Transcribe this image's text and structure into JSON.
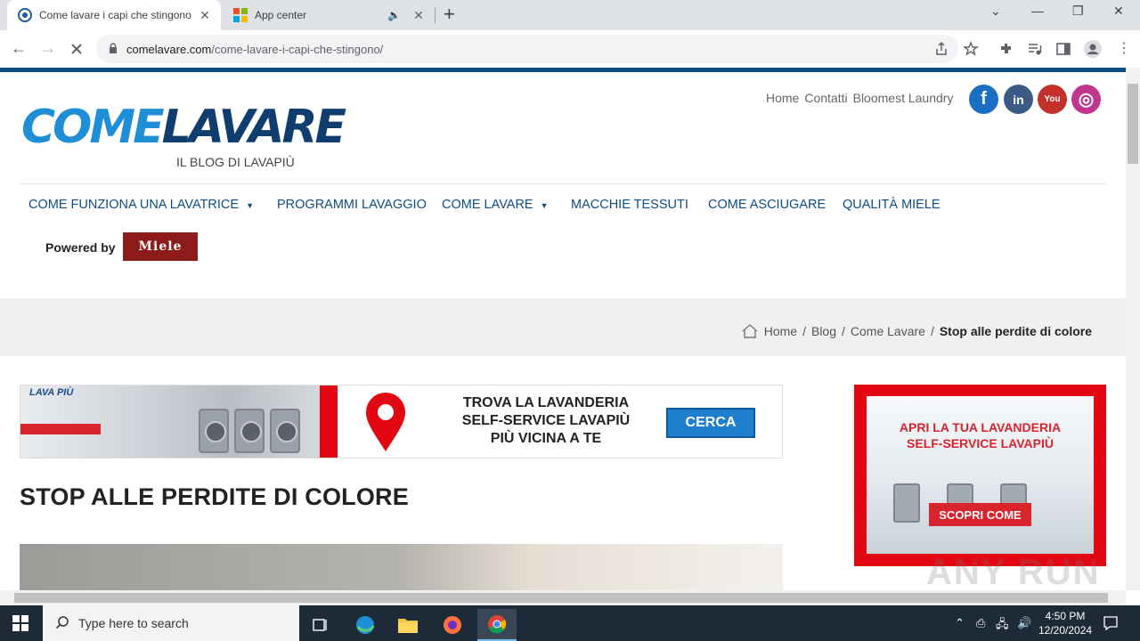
{
  "browser": {
    "tabs": [
      {
        "title": "Come lavare i capi che stingono",
        "active": true
      },
      {
        "title": "App center",
        "active": false
      }
    ],
    "url_domain": "comelavare.com",
    "url_path": "/come-lavare-i-capi-che-stingono/"
  },
  "site": {
    "logo_part1": "COME",
    "logo_part2": "LAVARE",
    "tagline": "IL BLOG DI LAVAPIÙ",
    "top_links": [
      "Home",
      "Contatti",
      "Bloomest Laundry"
    ],
    "social": [
      {
        "name": "facebook",
        "glyph": "f",
        "color": "#1b6fc2"
      },
      {
        "name": "linkedin",
        "glyph": "in",
        "color": "#3b5b86"
      },
      {
        "name": "youtube",
        "glyph": "You",
        "color": "#c4302b"
      },
      {
        "name": "instagram",
        "glyph": "◎",
        "color": "#c1358d"
      }
    ],
    "menu": [
      "COME FUNZIONA UNA LAVATRICE",
      "PROGRAMMI LAVAGGIO",
      "COME LAVARE",
      "MACCHIE TESSUTI",
      "COME ASCIUGARE",
      "QUALITÀ MIELE"
    ],
    "powered_by": "Powered by",
    "miele": "Miele"
  },
  "breadcrumb": {
    "items": [
      "Home",
      "Blog",
      "Come Lavare"
    ],
    "current": "Stop alle perdite di colore",
    "sep": "/"
  },
  "banner": {
    "brand": "LAVA PIÙ",
    "line1": "TROVA LA LAVANDERIA",
    "line2": "SELF-SERVICE LAVAPIÙ",
    "line3": "PIÙ VICINA A TE",
    "button": "CERCA"
  },
  "post": {
    "title": "STOP ALLE PERDITE DI COLORE"
  },
  "side_ad": {
    "line1": "APRI LA TUA LAVANDERIA",
    "line2": "SELF-SERVICE LAVAPIÙ",
    "button": "SCOPRI COME"
  },
  "watermark": "ANY RUN",
  "taskbar": {
    "search_placeholder": "Type here to search",
    "time": "4:50 PM",
    "date": "12/20/2024"
  }
}
